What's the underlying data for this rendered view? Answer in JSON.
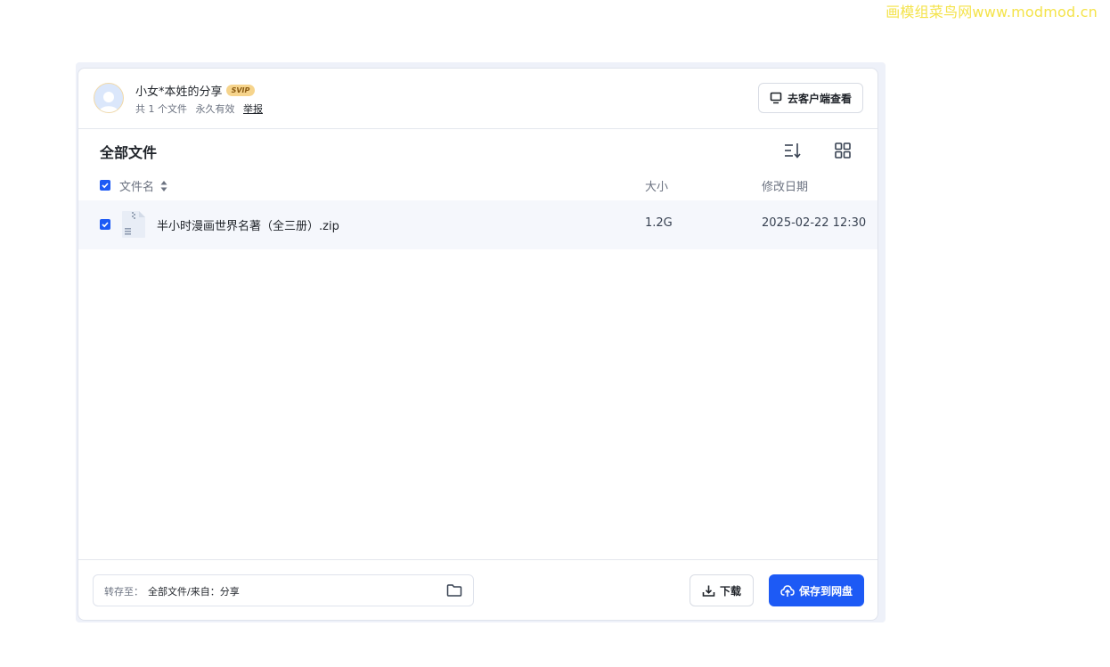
{
  "watermark": "画模组菜鸟网www.modmod.cn",
  "share": {
    "sharer_name": "小女*本姓的分享",
    "badge": "SVIP",
    "file_count": "共 1 个文件",
    "validity": "永久有效",
    "report_link": "举报",
    "client_button": "去客户端查看"
  },
  "toolbar": {
    "title": "全部文件",
    "sort_icon": "sort-list-icon",
    "view_icon": "grid-view-icon"
  },
  "table": {
    "headers": {
      "name": "文件名",
      "size": "大小",
      "date": "修改日期"
    },
    "rows": [
      {
        "name": "半小时漫画世界名著（全三册）.zip",
        "size": "1.2G",
        "date": "2025-02-22 12:30",
        "icon": "zip-file-icon",
        "checked": true
      }
    ]
  },
  "footer": {
    "dest_label": "转存至：",
    "dest_path": "全部文件/来自：分享",
    "download_button": "下载",
    "save_button": "保存到网盘"
  },
  "colors": {
    "primary": "#1d5af5",
    "badge": "#f6d48c",
    "row_bg": "#f5f7fc"
  }
}
